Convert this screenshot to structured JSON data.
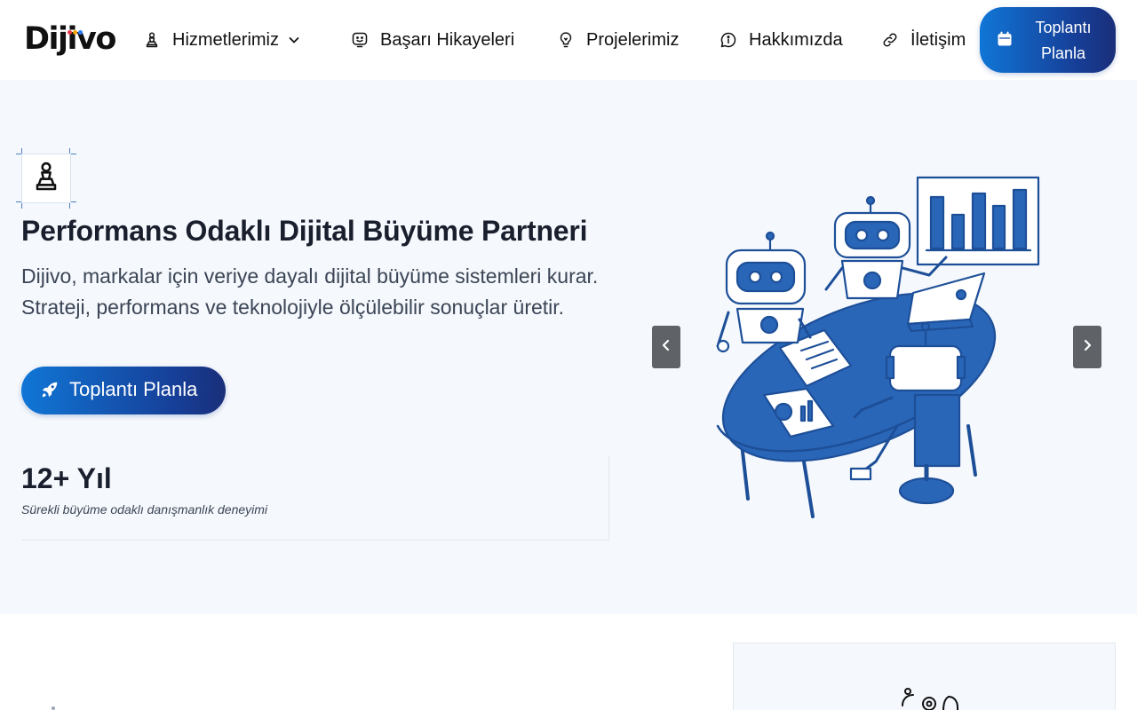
{
  "header": {
    "logo_text": "Dijivo",
    "logo_dot_colors": [
      "#e63946",
      "#f4a300",
      "#2bb673",
      "#2d7ff9"
    ],
    "nav": [
      {
        "label": "Hizmetlerimiz",
        "icon": "chess-pawn-icon",
        "has_dropdown": true
      },
      {
        "label": "Başarı Hikayeleri",
        "icon": "smile-monitor-icon"
      },
      {
        "label": "Projelerimiz",
        "icon": "lightbulb-icon"
      },
      {
        "label": "Hakkımızda",
        "icon": "info-chat-icon"
      },
      {
        "label": "İletişim",
        "icon": "link-icon"
      }
    ],
    "cta_label": "Toplantı Planla",
    "cta_icon": "calendar-icon"
  },
  "hero": {
    "badge_icon": "chess-pawn-icon",
    "title": "Performans Odaklı Dijital Büyüme Partneri",
    "description": "Dijivo, markalar için veriye dayalı dijital büyüme sistemleri kurar. Strateji, performans ve teknolojiyle ölçülebilir sonuçlar üretir.",
    "cta_label": "Toplantı Planla",
    "cta_icon": "rocket-icon",
    "stat": {
      "value": "12+ Yıl",
      "text": "Sürekli büyüme odaklı danışmanlık deneyimi"
    },
    "illustration": "robots-meeting-illustration"
  },
  "colors": {
    "accent_start": "#1076d6",
    "accent_end": "#1a2f7a",
    "hero_bg": "#f5f8fc",
    "illustration_blue": "#2a66b8",
    "text_dark": "#1a1f2e",
    "text_body": "#3b4556"
  }
}
